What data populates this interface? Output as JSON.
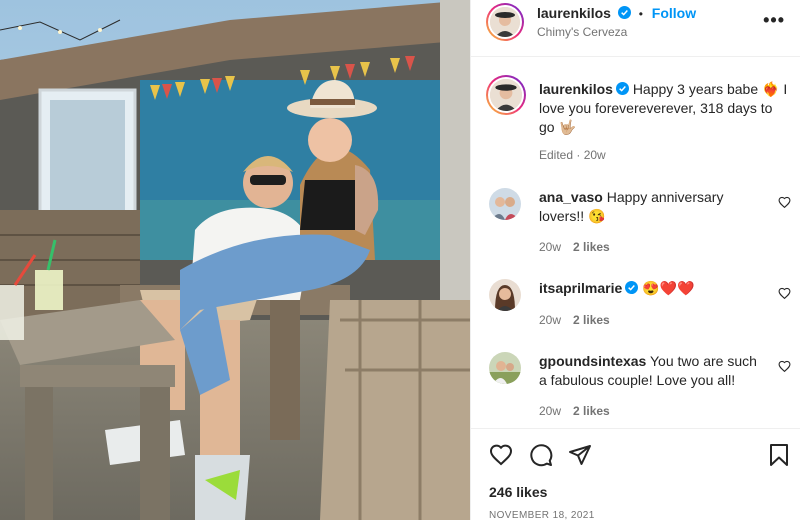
{
  "post": {
    "author": "laurenkilos",
    "follow_label": "Follow",
    "separator": "•",
    "more_label": "•••",
    "location": "Chimy's Cerveza",
    "caption_text": "Happy 3 years babe ❤️‍🔥 I love you forevereverever, 318 days to go 🤟🏼",
    "caption_meta": "Edited · 20w",
    "likes": "246 likes",
    "date": "November 18, 2021"
  },
  "comments": [
    {
      "user": "ana_vaso",
      "text": "Happy anniversary lovers!! 😘",
      "time": "20w",
      "likes": "2 likes",
      "verified": false
    },
    {
      "user": "itsaprilmarie",
      "text": "😍❤️❤️",
      "time": "20w",
      "likes": "2 likes",
      "verified": true
    },
    {
      "user": "gpoundsintexas",
      "text": "You two are such a fabulous couple! Love you all!",
      "time": "20w",
      "likes": "2 likes",
      "verified": false
    }
  ],
  "colors": {
    "accent": "#0095f6",
    "text": "#262626",
    "muted": "#737373",
    "verified": "#0095f6"
  },
  "icons": [
    "verified-icon",
    "more-options-icon",
    "heart-icon",
    "comment-icon",
    "share-icon",
    "bookmark-icon"
  ]
}
